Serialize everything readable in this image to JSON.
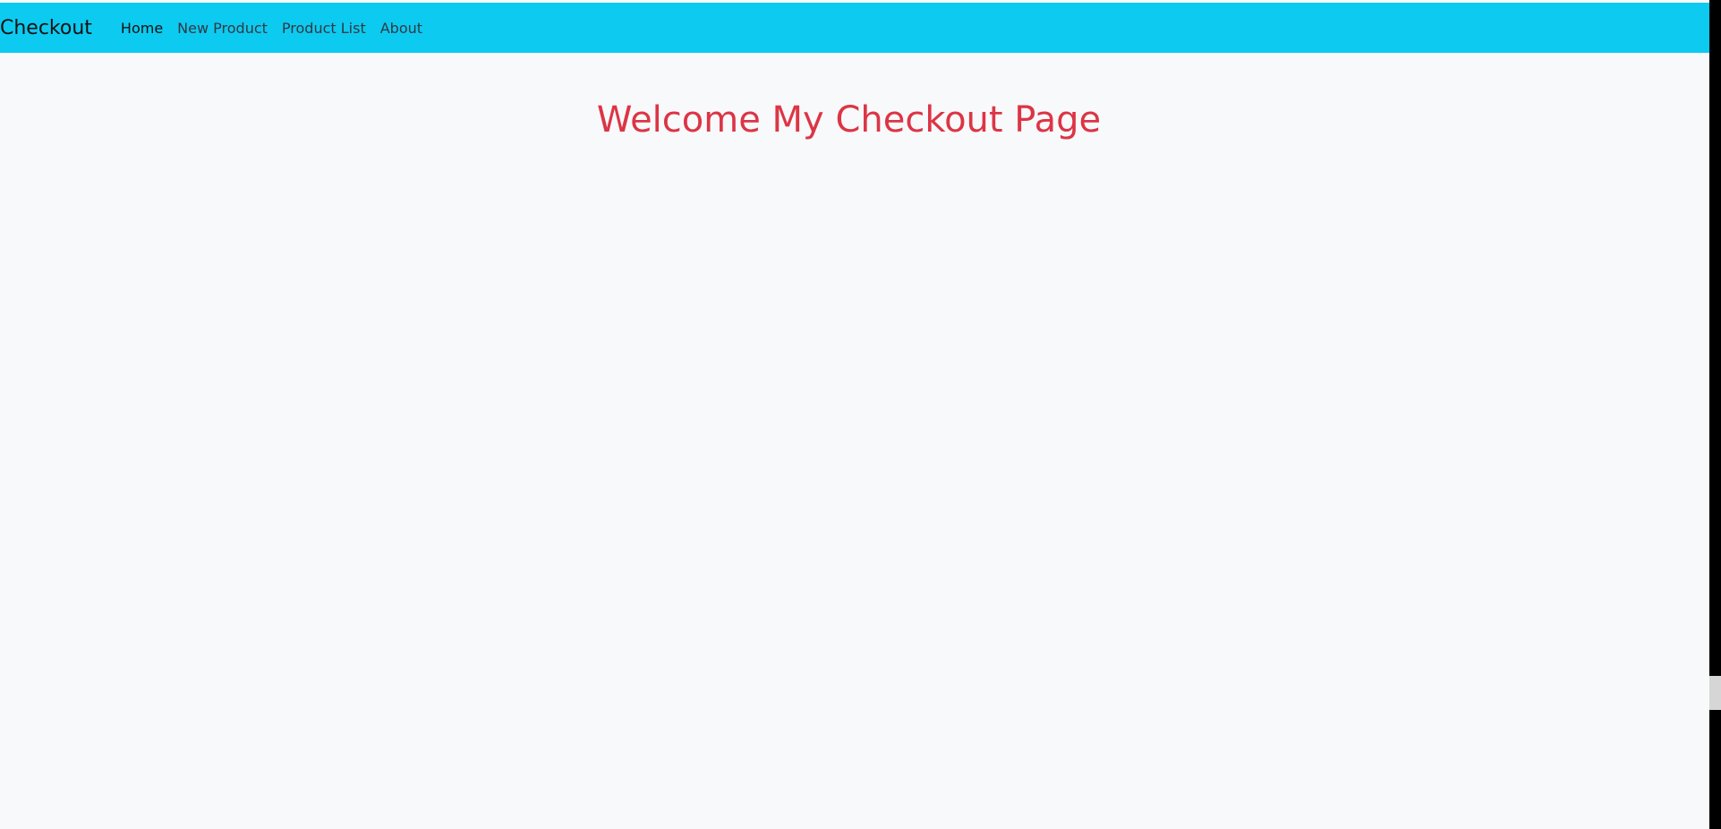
{
  "navbar": {
    "brand": "Checkout",
    "links": [
      {
        "label": "Home",
        "active": true
      },
      {
        "label": "New Product",
        "active": false
      },
      {
        "label": "Product List",
        "active": false
      },
      {
        "label": "About",
        "active": false
      }
    ]
  },
  "main": {
    "title": "Welcome My Checkout Page"
  },
  "colors": {
    "navbar_bg": "#0dcaf0",
    "page_bg": "#f8f9fb",
    "title": "#dc3545"
  }
}
